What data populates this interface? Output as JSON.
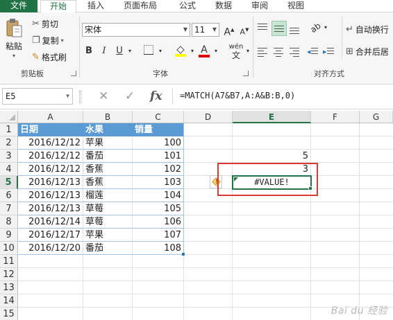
{
  "tabs": [
    "文件",
    "开始",
    "插入",
    "页面布局",
    "公式",
    "数据",
    "审阅",
    "视图"
  ],
  "clipboard": {
    "paste": "粘贴",
    "cut": "剪切",
    "copy": "复制",
    "format_painter": "格式刷",
    "group_label": "剪贴板"
  },
  "font": {
    "name": "宋体",
    "size": "11",
    "bold": "B",
    "italic": "I",
    "underline": "U",
    "grow": "A",
    "shrink": "A",
    "font_color": "A",
    "phonetic": "wén",
    "group_label": "字体"
  },
  "alignment": {
    "wrap_text": "自动换行",
    "merge_center": "合并后居",
    "group_label": "对齐方式"
  },
  "formula_bar": {
    "name_box": "E5",
    "cancel": "✕",
    "enter": "✓",
    "fx": "fx",
    "formula": "=MATCH(A7&B7,A:A&B:B,0)"
  },
  "columns": [
    "A",
    "B",
    "C",
    "D",
    "E",
    "F",
    "G"
  ],
  "rows": [
    "1",
    "2",
    "3",
    "4",
    "5",
    "6",
    "7",
    "8",
    "9",
    "10",
    "11",
    "12",
    "13",
    "14",
    "15"
  ],
  "table": {
    "headers": [
      "日期",
      "水果",
      "销量"
    ],
    "rows": [
      [
        "2016/12/12",
        "苹果",
        "100"
      ],
      [
        "2016/12/12",
        "番茄",
        "101"
      ],
      [
        "2016/12/12",
        "香蕉",
        "102"
      ],
      [
        "2016/12/13",
        "香蕉",
        "103"
      ],
      [
        "2016/12/13",
        "榴莲",
        "104"
      ],
      [
        "2016/12/13",
        "草莓",
        "105"
      ],
      [
        "2016/12/14",
        "草莓",
        "106"
      ],
      [
        "2016/12/17",
        "苹果",
        "107"
      ],
      [
        "2016/12/20",
        "番茄",
        "108"
      ]
    ]
  },
  "column_e": {
    "e3": "5",
    "e4": "3",
    "e5": "#VALUE!"
  },
  "error_indicator": "!",
  "watermark": "Bai du 经验",
  "colors": {
    "excel_green": "#217346",
    "table_header": "#5b9bd5",
    "highlight_red": "#e0373b"
  }
}
